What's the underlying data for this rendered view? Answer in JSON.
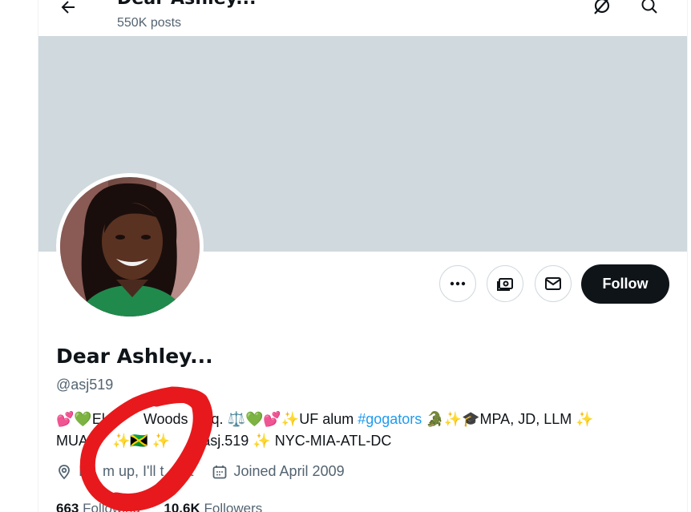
{
  "header": {
    "title": "Dear Ashley...",
    "posts_count": "550K posts"
  },
  "profile": {
    "name": "Dear Ashley...",
    "handle": "@asj519",
    "follow_label": "Follow",
    "bio": {
      "line1_a": "💕💚El",
      "line1_b": "Woods",
      "line1_c": "sq. ⚖️💚💕✨UF alum ",
      "hashtag": "#gogators",
      "line1_d": " 🐊✨🎓MPA, JD, LLM ✨",
      "line2_a": "MUA",
      "line2_b": "✨🇯🇲 ✨",
      "line2_c": "asj.519 ✨ NYC-MIA-ATL-DC"
    },
    "location": "It",
    "location_b": "m up, I'll t",
    "location_c": "t",
    "joined": "Joined April 2009",
    "following_count": "663",
    "following_label": "Following",
    "followers_count": "10.6K",
    "followers_label": "Followers"
  },
  "colors": {
    "banner": "#cfd9de",
    "accent": "#1d9bf0",
    "annotation": "#e8191c"
  },
  "icons": [
    "back-arrow-icon",
    "grok-icon",
    "search-icon",
    "more-icon",
    "subscribe-icon",
    "message-icon",
    "location-icon",
    "calendar-icon"
  ]
}
